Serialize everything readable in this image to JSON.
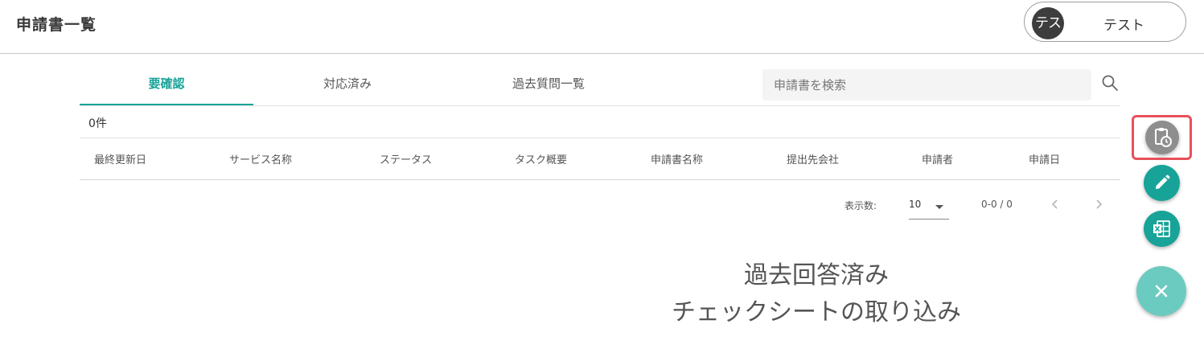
{
  "header": {
    "title": "申請書一覧",
    "user": {
      "avatar_text": "テス",
      "name": "テスト"
    }
  },
  "tabs": [
    {
      "label": "要確認",
      "active": true
    },
    {
      "label": "対応済み",
      "active": false
    },
    {
      "label": "過去質問一覧",
      "active": false
    }
  ],
  "search": {
    "placeholder": "申請書を検索",
    "icon": "search-icon"
  },
  "table": {
    "count_label": "0件",
    "columns": [
      "最終更新日",
      "サービス名称",
      "ステータス",
      "タスク概要",
      "申請書名称",
      "提出先会社",
      "申請者",
      "申請日"
    ],
    "rows": []
  },
  "pagination": {
    "rows_label": "表示数:",
    "rows_value": "10",
    "range_label": "0-0 / 0"
  },
  "fab_menu": {
    "items": [
      {
        "name": "history-checksheet-icon",
        "highlighted": true
      },
      {
        "name": "pencil-icon"
      },
      {
        "name": "excel-icon"
      },
      {
        "name": "close-icon"
      }
    ],
    "tooltip_lines": [
      "過去回答済み",
      "チェックシートの取り込み"
    ]
  },
  "colors": {
    "accent": "#17a398",
    "highlight": "#e8505b",
    "fab_main": "#6ccbc0",
    "fab_disabled": "#8e8e8e"
  }
}
